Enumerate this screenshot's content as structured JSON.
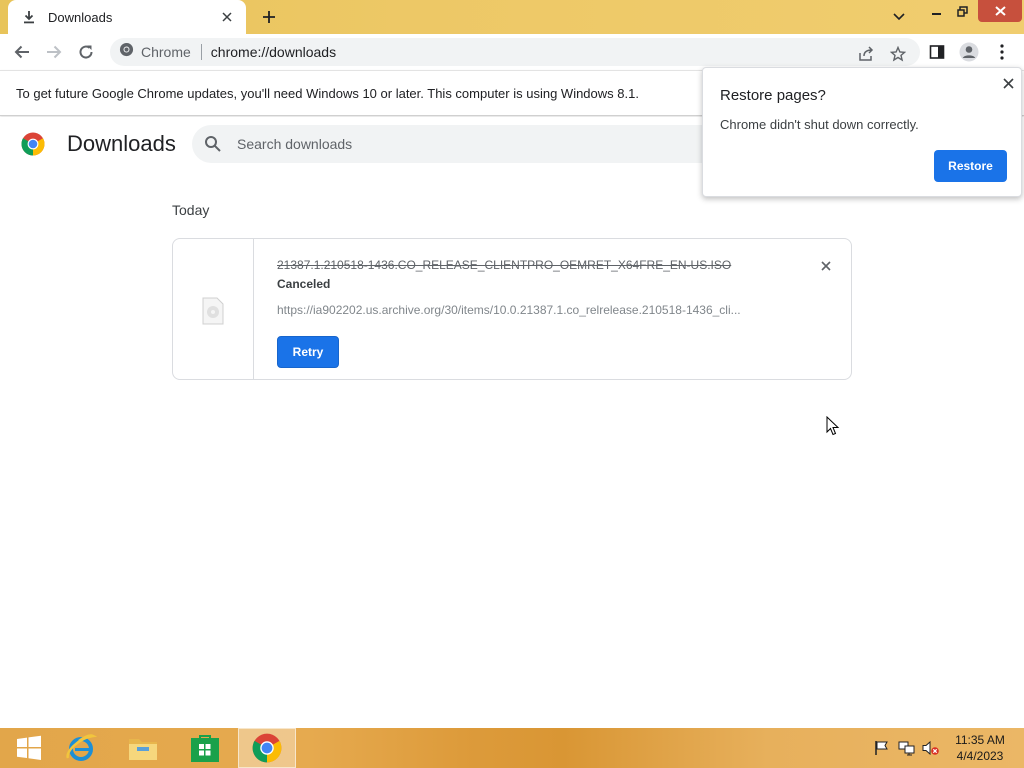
{
  "browser": {
    "tab": {
      "title": "Downloads"
    },
    "omnibox": {
      "site_label": "Chrome",
      "url": "chrome://downloads"
    }
  },
  "infobar": {
    "text": "To get future Google Chrome updates, you'll need Windows 10 or later. This computer is using Windows 8.1."
  },
  "downloads_page": {
    "title": "Downloads",
    "search_placeholder": "Search downloads",
    "group_label": "Today",
    "items": [
      {
        "file_name": "21387.1.210518-1436.CO_RELEASE_CLIENTPRO_OEMRET_X64FRE_EN-US.ISO",
        "status": "Canceled",
        "url": "https://ia902202.us.archive.org/30/items/10.0.21387.1.co_relrelease.210518-1436_cli...",
        "action_label": "Retry"
      }
    ]
  },
  "restore_popup": {
    "title": "Restore pages?",
    "body": "Chrome didn't shut down correctly.",
    "button_label": "Restore"
  },
  "taskbar": {
    "apps": [
      "start-icon",
      "internet-explorer-icon",
      "file-explorer-icon",
      "store-icon",
      "chrome-icon"
    ],
    "clock": {
      "time": "11:35 AM",
      "date": "4/4/2023"
    }
  },
  "colors": {
    "accent": "#1a73e8",
    "titlebar": "#edc866",
    "taskbar": "#e2a64a"
  }
}
